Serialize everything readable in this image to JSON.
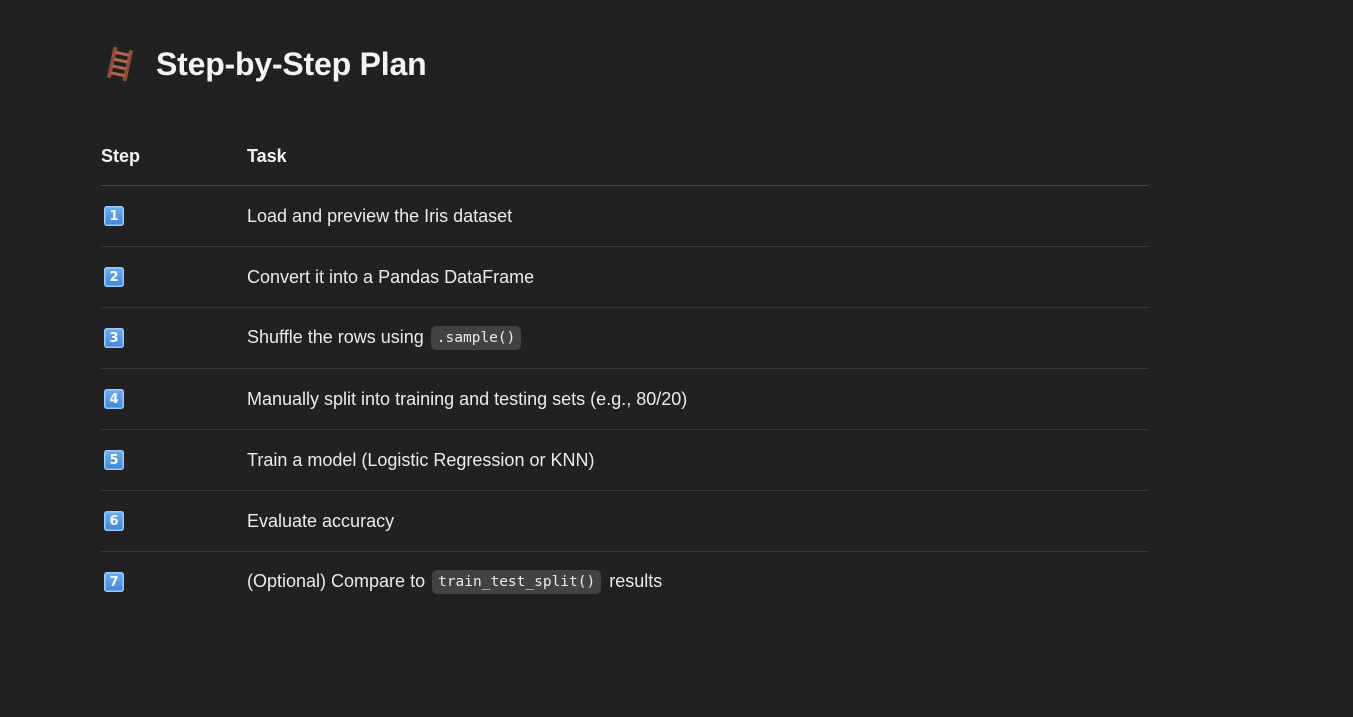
{
  "heading": {
    "icon": "ladder-icon",
    "title": "Step-by-Step Plan"
  },
  "table": {
    "headers": {
      "step": "Step",
      "task": "Task"
    },
    "rows": [
      {
        "step": "1",
        "pre": "Load and preview the Iris dataset",
        "code": "",
        "post": ""
      },
      {
        "step": "2",
        "pre": "Convert it into a Pandas DataFrame",
        "code": "",
        "post": ""
      },
      {
        "step": "3",
        "pre": "Shuffle the rows using",
        "code": ".sample()",
        "post": ""
      },
      {
        "step": "4",
        "pre": "Manually split into training and testing sets (e.g., 80/20)",
        "code": "",
        "post": ""
      },
      {
        "step": "5",
        "pre": "Train a model (Logistic Regression or KNN)",
        "code": "",
        "post": ""
      },
      {
        "step": "6",
        "pre": "Evaluate accuracy",
        "code": "",
        "post": ""
      },
      {
        "step": "7",
        "pre": "(Optional) Compare to",
        "code": "train_test_split()",
        "post": "results"
      }
    ]
  },
  "colors": {
    "background": "#212121",
    "text": "#ececec",
    "keycap": "#4a90e2",
    "code_bg": "#424242",
    "divider": "#3a3a3a"
  }
}
